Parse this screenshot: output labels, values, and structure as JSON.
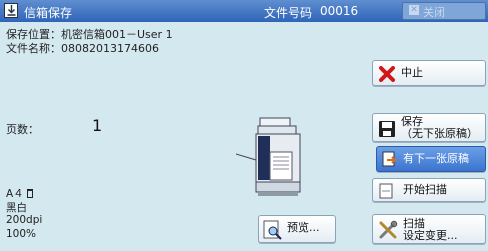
{
  "header": {
    "title": "信箱保存",
    "docno_label": "文件号码",
    "docno_value": "00016",
    "close_label": "关闭"
  },
  "info": {
    "location": "保存位置：机密信箱001－User 1",
    "filename": "文件名称：08082013174606",
    "pages_label": "页数：",
    "pages_value": "1"
  },
  "specs": {
    "paper": "A４",
    "color": "黑白",
    "resolution": "200dpi",
    "scale": "100%"
  },
  "buttons": {
    "stop": "中止",
    "save_line1": "保存",
    "save_line2": "（无下张原稿）",
    "next": "有下一张原稿",
    "start_scan": "开始扫描",
    "preview": "预览...",
    "scan_settings_line1": "扫描",
    "scan_settings_line2": "设定变更..."
  }
}
